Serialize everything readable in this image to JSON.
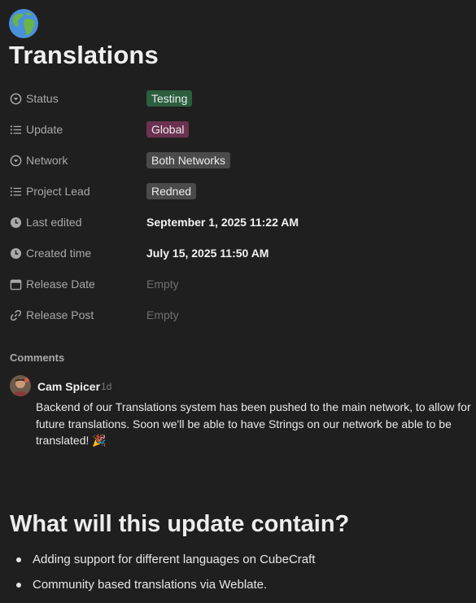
{
  "page": {
    "title": "Translations",
    "icon": "globe-icon"
  },
  "properties": [
    {
      "key": "Status",
      "icon": "status-icon",
      "value": "Testing",
      "kind": "tag",
      "color": "#2b5e3f"
    },
    {
      "key": "Update",
      "icon": "list-icon",
      "value": "Global",
      "kind": "tag",
      "color": "#6b3250"
    },
    {
      "key": "Network",
      "icon": "status-icon",
      "value": "Both Networks",
      "kind": "tag",
      "color": "#4a4a4a"
    },
    {
      "key": "Project Lead",
      "icon": "list-icon",
      "value": "Redned",
      "kind": "tag",
      "color": "#4a4a4a"
    },
    {
      "key": "Last edited",
      "icon": "clock-icon",
      "value": "September 1, 2025 11:22 AM",
      "kind": "text"
    },
    {
      "key": "Created time",
      "icon": "clock-icon",
      "value": "July 15, 2025 11:50 AM",
      "kind": "text"
    },
    {
      "key": "Release Date",
      "icon": "calendar-icon",
      "value": "Empty",
      "kind": "empty"
    },
    {
      "key": "Release Post",
      "icon": "link-icon",
      "value": "Empty",
      "kind": "empty"
    }
  ],
  "comments": {
    "heading": "Comments",
    "items": [
      {
        "author": "Cam Spicer",
        "age": "1d",
        "text": "Backend of our Translations system has been pushed to the main network, to allow for future translations. Soon we'll be able to have Strings on our network be able to be translated! 🎉"
      }
    ]
  },
  "section": {
    "heading": "What will this update contain?",
    "bullets": [
      "Adding support for different languages on CubeCraft",
      "Community based translations via Weblate."
    ]
  }
}
